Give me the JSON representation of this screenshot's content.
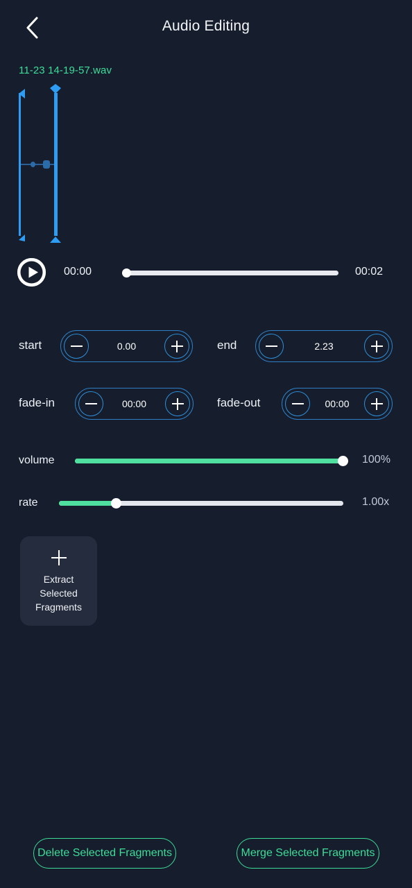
{
  "header": {
    "title": "Audio Editing",
    "back_icon": "chevron-left-icon"
  },
  "file": {
    "name": "11-23 14-19-57.wav"
  },
  "waveform": {
    "start_handle_icon": "selection-handle-start",
    "end_handle_icon": "selection-handle-end"
  },
  "playback": {
    "play_icon": "play-icon",
    "current_time": "00:00",
    "total_time": "00:02",
    "progress_percent": 0
  },
  "steppers": [
    {
      "label": "start",
      "value": "0.00",
      "minus_icon": "minus-icon",
      "plus_icon": "plus-icon"
    },
    {
      "label": "end",
      "value": "2.23",
      "minus_icon": "minus-icon",
      "plus_icon": "plus-icon"
    },
    {
      "label": "fade-in",
      "value": "00:00",
      "minus_icon": "minus-icon",
      "plus_icon": "plus-icon"
    },
    {
      "label": "fade-out",
      "value": "00:00",
      "minus_icon": "minus-icon",
      "plus_icon": "plus-icon"
    }
  ],
  "sliders": [
    {
      "label": "volume",
      "value_text": "100%",
      "fill_percent": 100
    },
    {
      "label": "rate",
      "value_text": "1.00x",
      "fill_percent": 20
    }
  ],
  "extract": {
    "icon": "plus-icon",
    "label": "Extract\nSelected\nFragments",
    "line1": "Extract",
    "line2": "Selected",
    "line3": "Fragments"
  },
  "bottom_actions": {
    "delete_label": "Delete Selected Fragments",
    "merge_label": "Merge Selected Fragments"
  },
  "colors": {
    "background": "#161e2e",
    "accent_green": "#3ddc97",
    "accent_blue": "#2f9cf4",
    "card": "#242c3e",
    "text": "#f0f2f6"
  }
}
